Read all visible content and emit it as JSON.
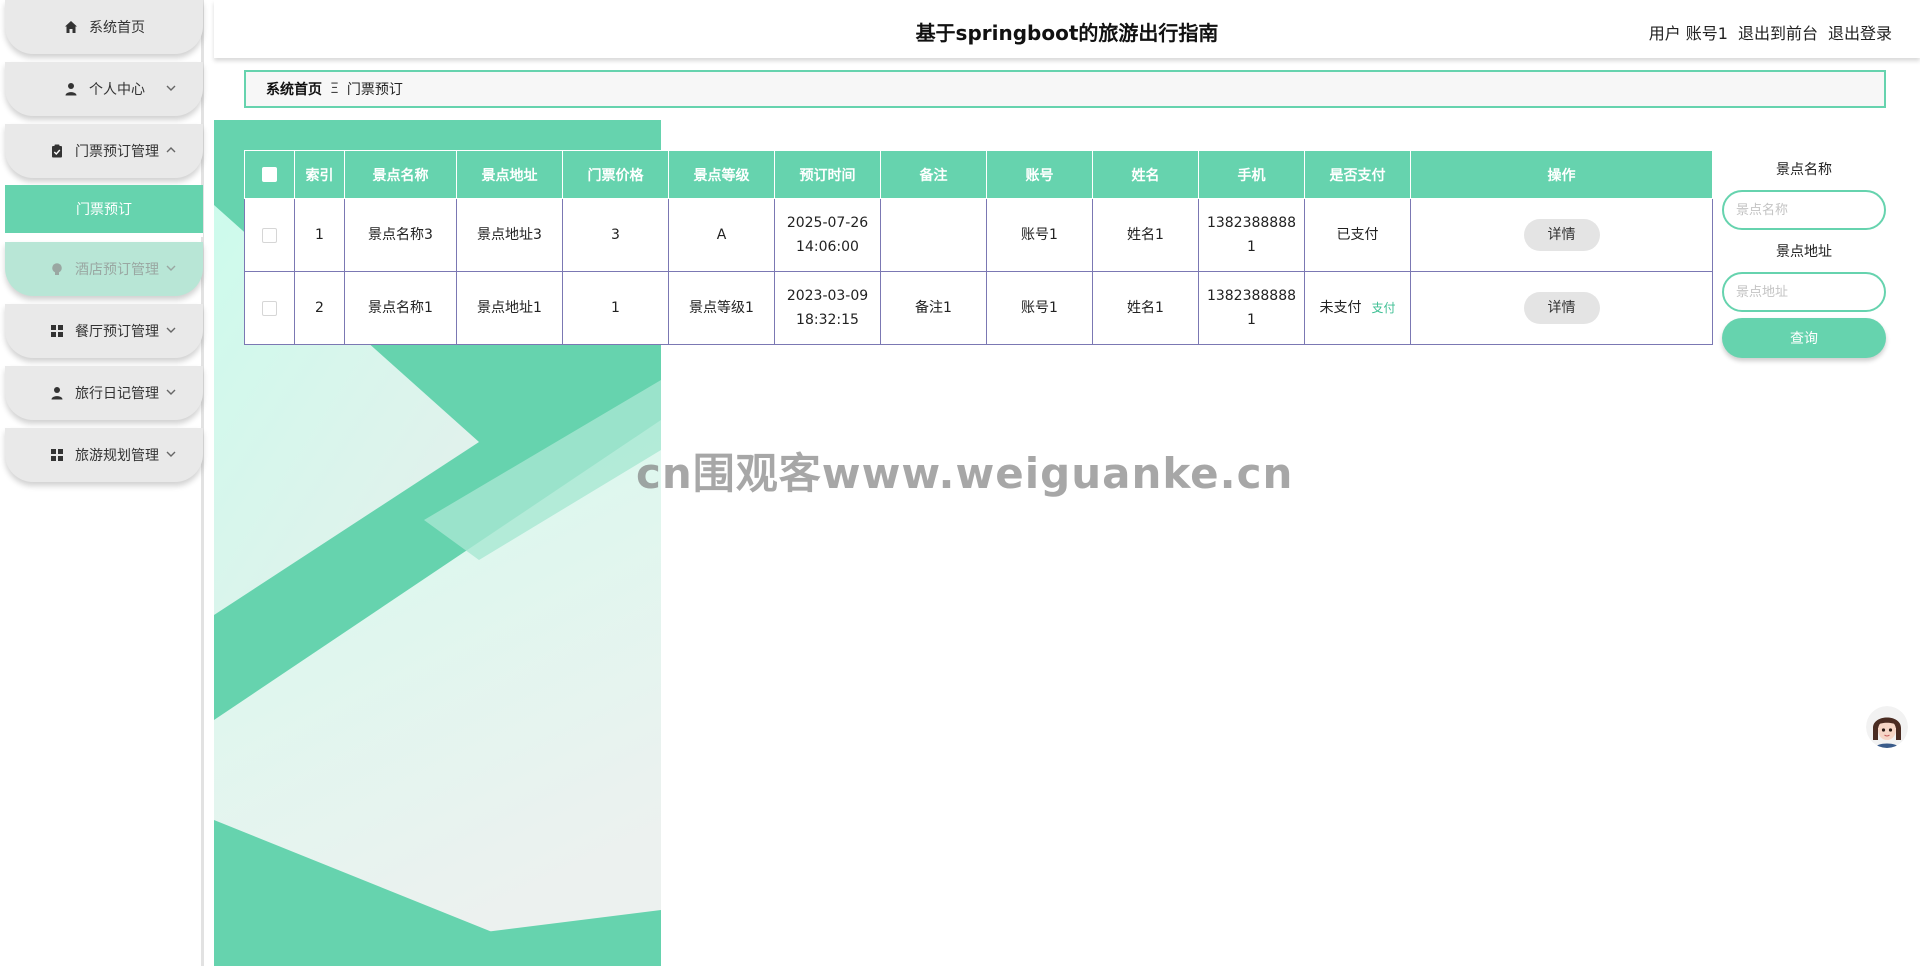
{
  "header": {
    "title": "基于springboot的旅游出行指南",
    "user_label": "用户 账号1",
    "back_front_label": "退出到前台",
    "logout_label": "退出登录"
  },
  "sidebar": {
    "items": [
      {
        "label": "系统首页",
        "icon": "home-icon"
      },
      {
        "label": "个人中心",
        "icon": "user-icon"
      },
      {
        "label": "门票预订管理",
        "icon": "clipboard-icon"
      },
      {
        "label": "酒店预订管理",
        "icon": "bulb-icon"
      },
      {
        "label": "餐厅预订管理",
        "icon": "grid-icon"
      },
      {
        "label": "旅行日记管理",
        "icon": "user-icon"
      },
      {
        "label": "旅游规划管理",
        "icon": "grid-icon"
      }
    ],
    "active_subitem": "门票预订"
  },
  "breadcrumb": {
    "home": "系统首页",
    "separator": "Ξ",
    "current": "门票预订"
  },
  "table": {
    "headers": [
      "索引",
      "景点名称",
      "景点地址",
      "门票价格",
      "景点等级",
      "预订时间",
      "备注",
      "账号",
      "姓名",
      "手机",
      "是否支付",
      "操作"
    ],
    "rows": [
      {
        "index": "1",
        "name": "景点名称3",
        "address": "景点地址3",
        "price": "3",
        "level": "A",
        "time_date": "2025-07-26",
        "time_clock": "14:06:00",
        "remark": "",
        "account": "账号1",
        "person": "姓名1",
        "phone_a": "1382388888",
        "phone_b": "1",
        "paid": "已支付",
        "pay_link": "",
        "action": "详情"
      },
      {
        "index": "2",
        "name": "景点名称1",
        "address": "景点地址1",
        "price": "1",
        "level": "景点等级1",
        "time_date": "2023-03-09",
        "time_clock": "18:32:15",
        "remark": "备注1",
        "account": "账号1",
        "person": "姓名1",
        "phone_a": "1382388888",
        "phone_b": "1",
        "paid": "未支付",
        "pay_link": "支付",
        "action": "详情"
      }
    ]
  },
  "search": {
    "name_label": "景点名称",
    "name_placeholder": "景点名称",
    "address_label": "景点地址",
    "address_placeholder": "景点地址",
    "button": "查询"
  },
  "watermark": "cn围观客www.weiguanke.cn",
  "colors": {
    "accent": "#66d3ae",
    "table_border": "#7b78b3",
    "pay_link": "#3dbf93"
  }
}
